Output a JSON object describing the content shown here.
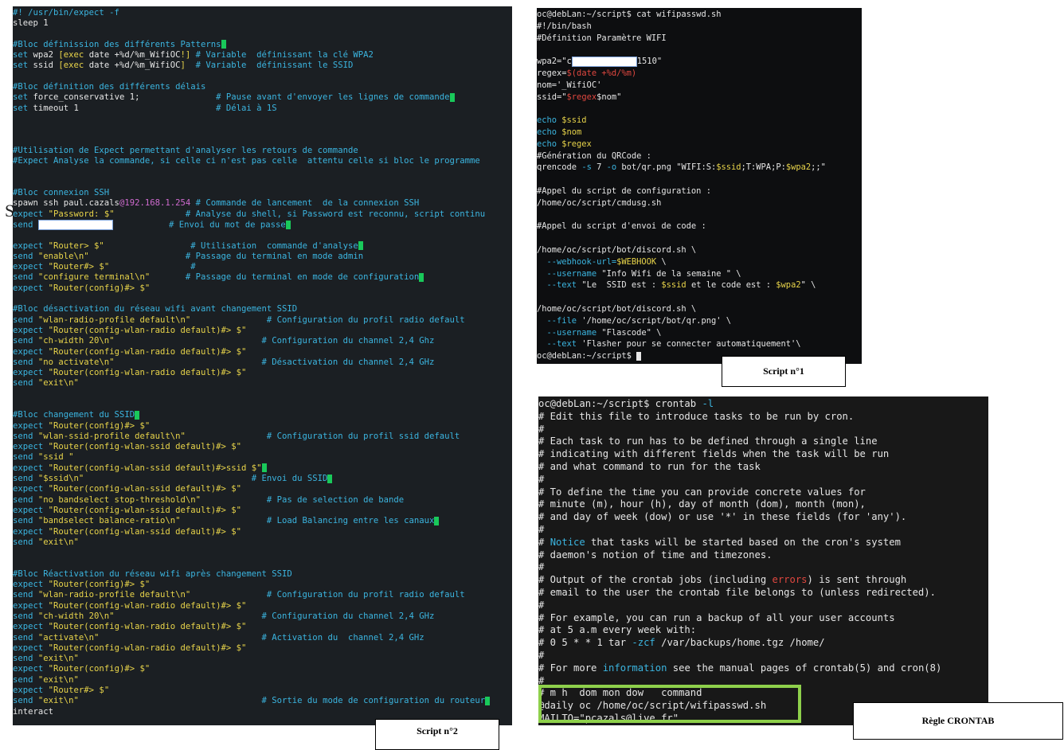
{
  "colors": {
    "comment": "#3bb5e0",
    "keyword": "#3bb5e0",
    "string": "#e8d44a",
    "plain": "#e6e6e6",
    "ip": "#d06bd0",
    "var": "#e8d44a",
    "red": "#e0473f",
    "highlight": "#8ed04b"
  },
  "script2": {
    "caption": "Script n°2",
    "lines": [
      [
        [
          "c",
          "#! /usr/bin/expect -f"
        ]
      ],
      [
        [
          "p",
          "sleep 1"
        ]
      ],
      [
        [
          "p",
          ""
        ]
      ],
      [
        [
          "c",
          "#Bloc définission des différents Patterns"
        ],
        [
          "cur",
          ""
        ]
      ],
      [
        [
          "k",
          "set "
        ],
        [
          "p",
          "wpa2 "
        ],
        [
          "s",
          "[exec "
        ],
        [
          "p",
          "date +%d/%m_WifiOC"
        ],
        [
          "s",
          "!] "
        ],
        [
          "c",
          "# Variable  définissant la clé WPA2"
        ]
      ],
      [
        [
          "k",
          "set "
        ],
        [
          "p",
          "ssid "
        ],
        [
          "s",
          "[exec "
        ],
        [
          "p",
          "date +%d/%m_WifiOC"
        ],
        [
          "s",
          "] "
        ],
        [
          "c",
          " # Variable  définissant le SSID"
        ]
      ],
      [
        [
          "p",
          ""
        ]
      ],
      [
        [
          "c",
          "#Bloc définition des différents délais"
        ]
      ],
      [
        [
          "k",
          "set "
        ],
        [
          "p",
          "force_conservative 1;"
        ],
        [
          "c",
          "               # Pause avant d'envoyer les lignes de commande"
        ],
        [
          "cur",
          ""
        ]
      ],
      [
        [
          "k",
          "set "
        ],
        [
          "p",
          "timeout 1"
        ],
        [
          "c",
          "                           # Délai à 1S"
        ]
      ],
      [
        [
          "p",
          ""
        ]
      ],
      [
        [
          "p",
          ""
        ]
      ],
      [
        [
          "p",
          ""
        ]
      ],
      [
        [
          "c",
          "#Utilisation de Expect permettant d'analyser les retours de commande"
        ]
      ],
      [
        [
          "c",
          "#Expect Analyse la commande, si celle ci n'est pas celle  attentu celle si bloc le programme"
        ]
      ],
      [
        [
          "p",
          ""
        ]
      ],
      [
        [
          "p",
          ""
        ]
      ],
      [
        [
          "c",
          "#Bloc connexion SSH"
        ]
      ],
      [
        [
          "p",
          "spawn ssh paul.cazals"
        ],
        [
          "ip",
          "@192.168.1.254"
        ],
        [
          "c",
          " # Commande de lancement  de la connexion SSH"
        ]
      ],
      [
        [
          "k",
          "expect "
        ],
        [
          "s",
          "\"Password: $\""
        ],
        [
          "c",
          "              # Analyse du shell, si Password est reconnu, script continu"
        ]
      ],
      [
        [
          "k",
          "send "
        ],
        [
          "mask",
          ""
        ],
        [
          "c",
          "           # Envoi du mot de passe"
        ],
        [
          "cur",
          ""
        ]
      ],
      [
        [
          "p",
          ""
        ]
      ],
      [
        [
          "k",
          "expect "
        ],
        [
          "s",
          "\"Router> $\""
        ],
        [
          "c",
          "                 # Utilisation  commande d'analyse"
        ],
        [
          "cur",
          ""
        ]
      ],
      [
        [
          "k",
          "send "
        ],
        [
          "s",
          "\"enable\\n\""
        ],
        [
          "c",
          "                   # Passage du terminal en mode admin"
        ]
      ],
      [
        [
          "k",
          "expect "
        ],
        [
          "s",
          "\"Router#> $\""
        ],
        [
          "c",
          "                #"
        ]
      ],
      [
        [
          "k",
          "send "
        ],
        [
          "s",
          "\"configure terminal\\n\""
        ],
        [
          "c",
          "       # Passage du terminal en mode de configuration"
        ],
        [
          "cur",
          ""
        ]
      ],
      [
        [
          "k",
          "expect "
        ],
        [
          "s",
          "\"Router(config)#> $\""
        ]
      ],
      [
        [
          "p",
          ""
        ]
      ],
      [
        [
          "c",
          "#Bloc désactivation du réseau wifi avant changement SSID"
        ]
      ],
      [
        [
          "k",
          "send "
        ],
        [
          "s",
          "\"wlan-radio-profile default\\n\""
        ],
        [
          "c",
          "               # Configuration du profil radio default"
        ]
      ],
      [
        [
          "k",
          "expect "
        ],
        [
          "s",
          "\"Router(config-wlan-radio default)#> $\""
        ]
      ],
      [
        [
          "k",
          "send "
        ],
        [
          "s",
          "\"ch-width 20\\n\""
        ],
        [
          "c",
          "                             # Configuration du channel 2,4 Ghz"
        ]
      ],
      [
        [
          "k",
          "expect "
        ],
        [
          "s",
          "\"Router(config-wlan-radio default)#> $\""
        ]
      ],
      [
        [
          "k",
          "send "
        ],
        [
          "s",
          "\"no activate\\n\""
        ],
        [
          "c",
          "                             # Désactivation du channel 2,4 GHz"
        ]
      ],
      [
        [
          "k",
          "expect "
        ],
        [
          "s",
          "\"Router(config-wlan-radio default)#> $\""
        ]
      ],
      [
        [
          "k",
          "send "
        ],
        [
          "s",
          "\"exit\\n\""
        ]
      ],
      [
        [
          "p",
          ""
        ]
      ],
      [
        [
          "p",
          ""
        ]
      ],
      [
        [
          "c",
          "#Bloc changement du SSID"
        ],
        [
          "cur",
          ""
        ]
      ],
      [
        [
          "k",
          "expect "
        ],
        [
          "s",
          "\"Router(config)#> $\""
        ]
      ],
      [
        [
          "k",
          "send "
        ],
        [
          "s",
          "\"wlan-ssid-profile default\\n\""
        ],
        [
          "c",
          "                # Configuration du profil ssid default"
        ]
      ],
      [
        [
          "k",
          "expect "
        ],
        [
          "s",
          "\"Router(config-wlan-ssid default)#> $\""
        ]
      ],
      [
        [
          "k",
          "send "
        ],
        [
          "s",
          "\"ssid \""
        ]
      ],
      [
        [
          "k",
          "expect "
        ],
        [
          "s",
          "\"Router(config-wlan-ssid default)#>ssid $\""
        ],
        [
          "cur",
          ""
        ]
      ],
      [
        [
          "k",
          "send "
        ],
        [
          "s",
          "\"$ssid\\n\""
        ],
        [
          "c",
          "                                 # Envoi du SSID"
        ],
        [
          "cur",
          ""
        ]
      ],
      [
        [
          "k",
          "expect "
        ],
        [
          "s",
          "\"Router(config-wlan-ssid default)#> $\""
        ]
      ],
      [
        [
          "k",
          "send "
        ],
        [
          "s",
          "\"no bandselect stop-threshold\\n\""
        ],
        [
          "c",
          "             # Pas de selection de bande"
        ]
      ],
      [
        [
          "k",
          "expect "
        ],
        [
          "s",
          "\"Router(config-wlan-ssid default)#> $\""
        ]
      ],
      [
        [
          "k",
          "send "
        ],
        [
          "s",
          "\"bandselect balance-ratio\\n\""
        ],
        [
          "c",
          "                 # Load Balancing entre les canaux"
        ],
        [
          "cur",
          ""
        ]
      ],
      [
        [
          "k",
          "expect "
        ],
        [
          "s",
          "\"Router(config-wlan-ssid default)#> $\""
        ]
      ],
      [
        [
          "k",
          "send "
        ],
        [
          "s",
          "\"exit\\n\""
        ]
      ],
      [
        [
          "p",
          ""
        ]
      ],
      [
        [
          "p",
          ""
        ]
      ],
      [
        [
          "c",
          "#Bloc Réactivation du réseau wifi après changement SSID"
        ]
      ],
      [
        [
          "k",
          "expect "
        ],
        [
          "s",
          "\"Router(config)#> $\""
        ]
      ],
      [
        [
          "k",
          "send "
        ],
        [
          "s",
          "\"wlan-radio-profile default\\n\""
        ],
        [
          "c",
          "               # Configuration du profil radio default"
        ]
      ],
      [
        [
          "k",
          "expect "
        ],
        [
          "s",
          "\"Router(config-wlan-radio default)#> $\""
        ]
      ],
      [
        [
          "k",
          "send "
        ],
        [
          "s",
          "\"ch-width 20\\n\""
        ],
        [
          "c",
          "                             # Configuration du channel 2,4 GHz"
        ]
      ],
      [
        [
          "k",
          "expect "
        ],
        [
          "s",
          "\"Router(config-wlan-radio default)#> $\""
        ]
      ],
      [
        [
          "k",
          "send "
        ],
        [
          "s",
          "\"activate\\n\""
        ],
        [
          "c",
          "                                # Activation du  channel 2,4 GHz"
        ]
      ],
      [
        [
          "k",
          "expect "
        ],
        [
          "s",
          "\"Router(config-wlan-radio default)#> $\""
        ]
      ],
      [
        [
          "k",
          "send "
        ],
        [
          "s",
          "\"exit\\n\""
        ]
      ],
      [
        [
          "k",
          "expect "
        ],
        [
          "s",
          "\"Router(config)#> $\""
        ]
      ],
      [
        [
          "k",
          "send "
        ],
        [
          "s",
          "\"exit\\n\""
        ]
      ],
      [
        [
          "k",
          "expect "
        ],
        [
          "s",
          "\"Router#> $\""
        ]
      ],
      [
        [
          "k",
          "send "
        ],
        [
          "s",
          "\"exit\\n\""
        ],
        [
          "c",
          "                                    # Sortie du mode de configuration du routeur"
        ],
        [
          "cur",
          ""
        ]
      ],
      [
        [
          "p",
          "interact"
        ]
      ]
    ]
  },
  "script1": {
    "caption": "Script n°1",
    "lines": [
      [
        [
          "p",
          "oc@debLan:~/script$ cat wifipasswd.sh"
        ]
      ],
      [
        [
          "p",
          "#!/bin/bash"
        ]
      ],
      [
        [
          "p",
          "#Définition Paramètre WIFI"
        ]
      ],
      [
        [
          "p",
          ""
        ]
      ],
      [
        [
          "p",
          "wpa2=\"c"
        ],
        [
          "mask",
          ""
        ],
        [
          "p",
          "1510\""
        ]
      ],
      [
        [
          "p",
          "regex="
        ],
        [
          "r",
          "$(date +%d/%m)"
        ]
      ],
      [
        [
          "p",
          "nom='_WifiOC'"
        ]
      ],
      [
        [
          "p",
          "ssid=\""
        ],
        [
          "r",
          "$regex"
        ],
        [
          "p",
          "$nom\""
        ]
      ],
      [
        [
          "p",
          ""
        ]
      ],
      [
        [
          "k",
          "echo "
        ],
        [
          "s",
          "$ssid"
        ]
      ],
      [
        [
          "k",
          "echo "
        ],
        [
          "s",
          "$nom"
        ]
      ],
      [
        [
          "k",
          "echo "
        ],
        [
          "s",
          "$regex"
        ]
      ],
      [
        [
          "p",
          "#Génération du QRCode :"
        ]
      ],
      [
        [
          "p",
          "qrencode "
        ],
        [
          "k",
          "-s "
        ],
        [
          "p",
          "7 "
        ],
        [
          "k",
          "-o "
        ],
        [
          "p",
          "bot/qr.png \"WIFI:S:"
        ],
        [
          "s",
          "$ssid"
        ],
        [
          "p",
          ";T:WPA;P:"
        ],
        [
          "s",
          "$wpa2"
        ],
        [
          "p",
          ";;\""
        ]
      ],
      [
        [
          "p",
          ""
        ]
      ],
      [
        [
          "p",
          "#Appel du script de configuration :"
        ]
      ],
      [
        [
          "p",
          "/home/oc/script/cmdusg.sh"
        ]
      ],
      [
        [
          "p",
          ""
        ]
      ],
      [
        [
          "p",
          "#Appel du script d'envoi de code :"
        ]
      ],
      [
        [
          "p",
          ""
        ]
      ],
      [
        [
          "p",
          "/home/oc/script/bot/discord.sh \\"
        ]
      ],
      [
        [
          "k",
          "  --webhook-url="
        ],
        [
          "s",
          "$WEBHOOK"
        ],
        [
          "p",
          " \\"
        ]
      ],
      [
        [
          "k",
          "  --username "
        ],
        [
          "p",
          "\"Info "
        ],
        [
          "p",
          "Wifi de la semaine \" \\"
        ]
      ],
      [
        [
          "k",
          "  --text "
        ],
        [
          "p",
          "\"Le  SSID est : "
        ],
        [
          "s",
          "$ssid"
        ],
        [
          "p",
          " et le code est : "
        ],
        [
          "s",
          "$wpa2"
        ],
        [
          "p",
          "\" \\"
        ]
      ],
      [
        [
          "p",
          ""
        ]
      ],
      [
        [
          "p",
          "/home/oc/script/bot/discord.sh \\"
        ]
      ],
      [
        [
          "k",
          "  --file "
        ],
        [
          "p",
          "'/home/oc/script/bot/qr.png' \\"
        ]
      ],
      [
        [
          "k",
          "  --username "
        ],
        [
          "p",
          "\"Flascode\" \\"
        ]
      ],
      [
        [
          "k",
          "  --text "
        ],
        [
          "p",
          "'Flasher pour se connecter automatiquement'\\"
        ]
      ],
      [
        [
          "p",
          "oc@debLan:~/script$ "
        ],
        [
          "ccur",
          ""
        ]
      ]
    ]
  },
  "crontab": {
    "caption": "Règle CRONTAB",
    "lines": [
      [
        [
          "p",
          "oc@debLan:~/script$ crontab "
        ],
        [
          "k",
          "-l"
        ]
      ],
      [
        [
          "p",
          "# Edit this file to introduce tasks to be run by cron."
        ]
      ],
      [
        [
          "p",
          "#"
        ]
      ],
      [
        [
          "p",
          "# Each task to run has to be defined through a single line"
        ]
      ],
      [
        [
          "p",
          "# indicating with different fields when the task will be run"
        ]
      ],
      [
        [
          "p",
          "# and what command to run for the task"
        ]
      ],
      [
        [
          "p",
          "#"
        ]
      ],
      [
        [
          "p",
          "# To define the time you can provide concrete values for"
        ]
      ],
      [
        [
          "p",
          "# minute (m), hour (h), day of month (dom), month (mon),"
        ]
      ],
      [
        [
          "p",
          "# and day of week (dow) or use '*' in these fields (for 'any')."
        ]
      ],
      [
        [
          "p",
          "#"
        ]
      ],
      [
        [
          "p",
          "# "
        ],
        [
          "k",
          "Notice"
        ],
        [
          "p",
          " that tasks will be started based on the cron's system"
        ]
      ],
      [
        [
          "p",
          "# daemon's notion of time and timezones."
        ]
      ],
      [
        [
          "p",
          "#"
        ]
      ],
      [
        [
          "p",
          "# Output of the crontab jobs (including "
        ],
        [
          "r",
          "errors"
        ],
        [
          "p",
          ") is sent through"
        ]
      ],
      [
        [
          "p",
          "# email to the user the crontab file belongs to (unless redirected)."
        ]
      ],
      [
        [
          "p",
          "#"
        ]
      ],
      [
        [
          "p",
          "# For example, you can run a backup of all your user accounts"
        ]
      ],
      [
        [
          "p",
          "# at 5 a.m every week with:"
        ]
      ],
      [
        [
          "p",
          "# 0 5 * * 1 tar "
        ],
        [
          "k",
          "-zcf"
        ],
        [
          "p",
          " /var/backups/home.tgz /home/"
        ]
      ],
      [
        [
          "p",
          "#"
        ]
      ],
      [
        [
          "p",
          "# For more "
        ],
        [
          "k",
          "information"
        ],
        [
          "p",
          " see the manual pages of crontab(5) and cron(8)"
        ]
      ],
      [
        [
          "p",
          "#"
        ]
      ],
      [
        [
          "p",
          "# m h  dom mon dow   command"
        ]
      ],
      [
        [
          "p",
          "@daily oc /home/oc/script/wifipasswd.sh"
        ]
      ],
      [
        [
          "p",
          "MAILTO=\"pcazals@live.fr\""
        ]
      ]
    ]
  },
  "stray_text": "S"
}
